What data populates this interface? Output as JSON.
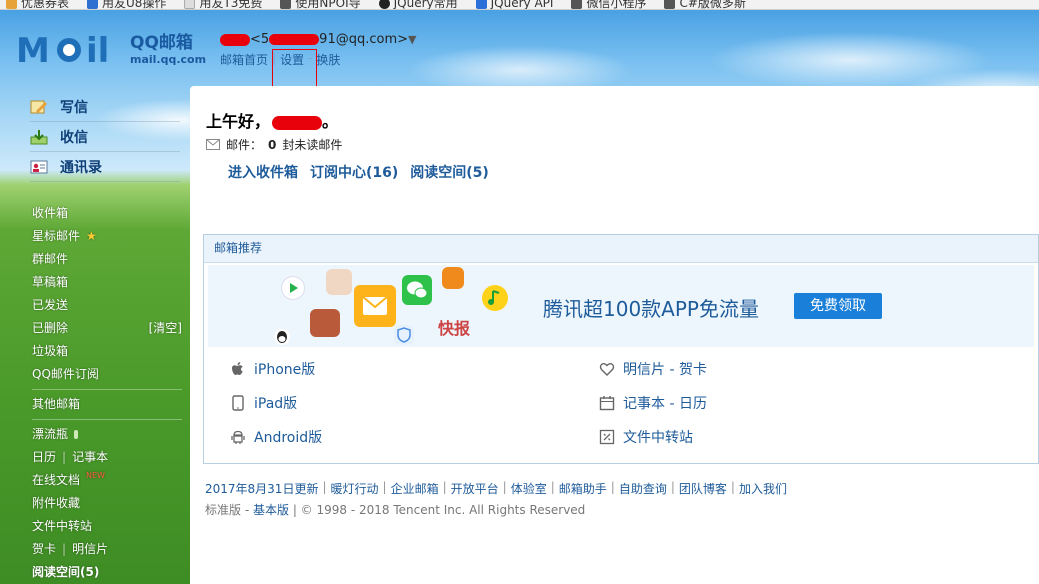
{
  "bookmarks": [
    "优惠券表",
    "用友U8操作",
    "用友T3免费",
    "使用NPOI导",
    "JQuery常用",
    "JQuery API",
    "微信小程序",
    "C#版微多斯"
  ],
  "logo": {
    "title": "QQ邮箱",
    "sub": "mail.qq.com"
  },
  "account": {
    "email_prefix": "<5",
    "email_suffix": "91@qq.com>",
    "caret": "▼"
  },
  "topnav": {
    "home": "邮箱首页",
    "settings": "设置",
    "skin": "换肤",
    "sep": "|",
    "sep2": "-"
  },
  "sidebar": {
    "compose": "写信",
    "receive": "收信",
    "contacts": "通讯录",
    "folders": [
      {
        "label": "收件箱"
      },
      {
        "label": "星标邮件",
        "star": "★"
      },
      {
        "label": "群邮件"
      },
      {
        "label": "草稿箱"
      },
      {
        "label": "已发送"
      },
      {
        "label": "已删除",
        "right": "[清空]"
      },
      {
        "label": "垃圾箱"
      },
      {
        "label": "QQ邮件订阅"
      }
    ],
    "other_mailbox": "其他邮箱",
    "extras": [
      {
        "label": "漂流瓶"
      },
      {
        "label": "日历",
        "second": "记事本"
      },
      {
        "label": "在线文档"
      },
      {
        "label": "附件收藏"
      },
      {
        "label": "文件中转站"
      },
      {
        "label": "贺卡",
        "second": "明信片"
      },
      {
        "label": "阅读空间(5)"
      }
    ]
  },
  "main": {
    "greeting": "上午好，",
    "greeting_tail": "。",
    "mail_label": "邮件：",
    "unread_count": "0",
    "unread_text": "封未读邮件",
    "links": [
      "进入收件箱",
      "订阅中心(16)",
      "阅读空间(5)"
    ]
  },
  "recommend": {
    "header": "邮箱推荐",
    "banner_text": "腾讯超100款APP免流量",
    "banner_button": "免费领取",
    "tools": [
      {
        "label": "iPhone版",
        "icon": "apple-icon"
      },
      {
        "label": "明信片 - 贺卡",
        "icon": "heart-icon"
      },
      {
        "label": "iPad版",
        "icon": "ipad-icon"
      },
      {
        "label": "记事本 - 日历",
        "icon": "calendar-icon"
      },
      {
        "label": "Android版",
        "icon": "android-icon"
      },
      {
        "label": "文件中转站",
        "icon": "transfer-icon"
      }
    ]
  },
  "footer": {
    "links": [
      "2017年8月31日更新",
      "暖灯行动",
      "企业邮箱",
      "开放平台",
      "体验室",
      "邮箱助手",
      "自助查询",
      "团队博客",
      "加入我们"
    ],
    "version_prefix": "标准版",
    "version_link": "基本版",
    "copyright": "© 1998 - 2018 Tencent Inc. All Rights Reserved"
  }
}
